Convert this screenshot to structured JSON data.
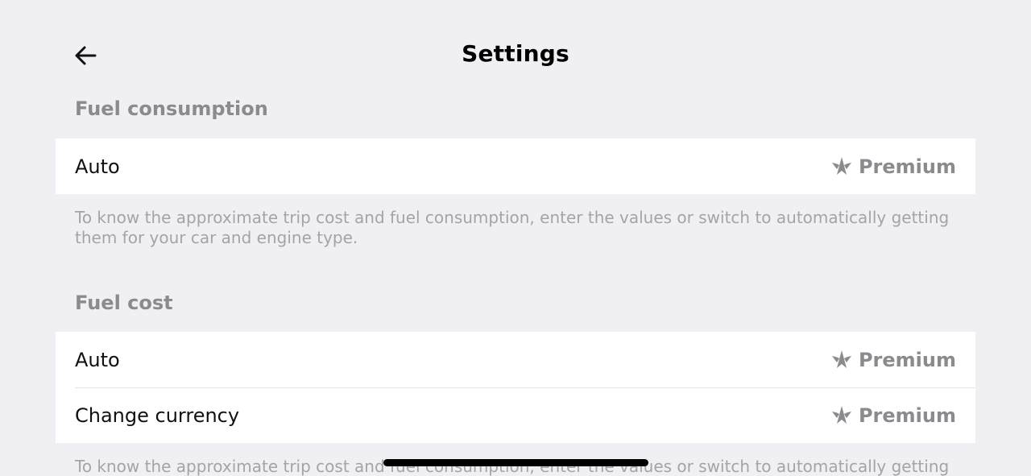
{
  "header": {
    "title": "Settings",
    "back_icon": "arrow-left-icon"
  },
  "sections": [
    {
      "title": "Fuel consumption",
      "rows": [
        {
          "label": "Auto",
          "badge": "Premium",
          "badge_icon": "premium-star-icon"
        }
      ],
      "hint": "To know the approximate trip cost and fuel consumption, enter the values or switch to automatically getting them for your car and engine type."
    },
    {
      "title": "Fuel cost",
      "rows": [
        {
          "label": "Auto",
          "badge": "Premium",
          "badge_icon": "premium-star-icon"
        },
        {
          "label": "Change currency",
          "badge": "Premium",
          "badge_icon": "premium-star-icon"
        }
      ],
      "hint": "To know the approximate trip cost and fuel consumption, enter the values or switch to automatically getting"
    }
  ],
  "colors": {
    "background": "#f0f0f4",
    "card": "#ffffff",
    "section_title": "#8b8b8f",
    "hint": "#a4a4a8",
    "premium": "#8b8b8f"
  }
}
